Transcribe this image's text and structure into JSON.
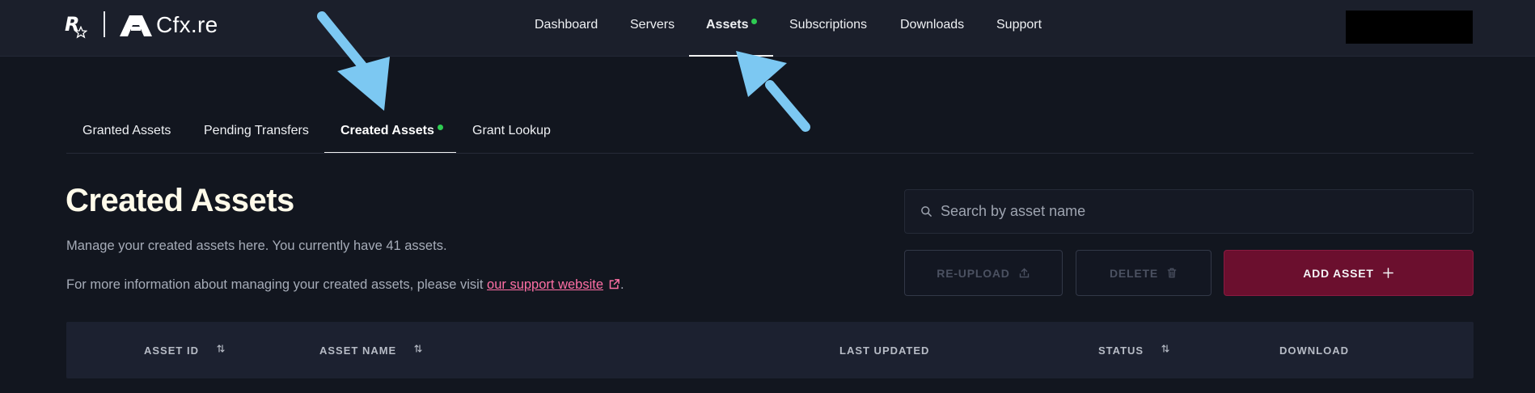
{
  "topnav": {
    "brand_r": "R",
    "brand_cfx": "Cfx.re",
    "items": [
      {
        "label": "Dashboard",
        "active": false
      },
      {
        "label": "Servers",
        "active": false
      },
      {
        "label": "Assets",
        "active": true,
        "indicator": true
      },
      {
        "label": "Subscriptions",
        "active": false
      },
      {
        "label": "Downloads",
        "active": false
      },
      {
        "label": "Support",
        "active": false
      }
    ]
  },
  "subtabs": [
    {
      "label": "Granted Assets",
      "active": false
    },
    {
      "label": "Pending Transfers",
      "active": false
    },
    {
      "label": "Created Assets",
      "active": true,
      "indicator": true
    },
    {
      "label": "Grant Lookup",
      "active": false
    }
  ],
  "page": {
    "title": "Created Assets",
    "description": "Manage your created assets here. You currently have 41 assets.",
    "info_prefix": "For more information about managing your created assets, please visit ",
    "info_link": "our support website",
    "info_suffix": "."
  },
  "search": {
    "placeholder": "Search by asset name",
    "value": ""
  },
  "buttons": {
    "reupload": "RE-UPLOAD",
    "delete": "DELETE",
    "add": "ADD ASSET"
  },
  "table": {
    "columns": [
      "ASSET ID",
      "ASSET NAME",
      "LAST UPDATED",
      "STATUS",
      "DOWNLOAD"
    ]
  },
  "colors": {
    "accent": "#6b0f2e",
    "indicator": "#2ecc52",
    "link": "#ff6fa5",
    "annotation_arrow": "#7cc8f2"
  },
  "icons": [
    "search-icon",
    "upload-icon",
    "trash-icon",
    "plus-icon",
    "external-link-icon",
    "sort-icon",
    "star-icon"
  ]
}
